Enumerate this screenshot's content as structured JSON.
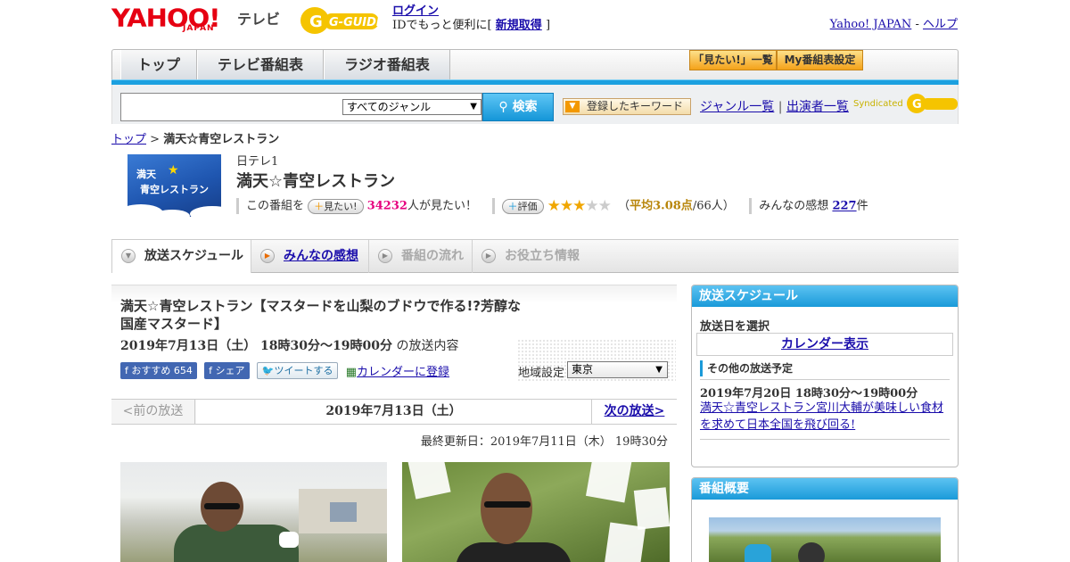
{
  "header": {
    "logo_yahoo": "YAHOO!",
    "logo_japan": "JAPAN",
    "logo_tv": "テレビ",
    "gguide_logo": "G-GUIDE",
    "login_label": "ログイン",
    "id_prefix": "IDでもっと便利に[",
    "register_label": "新規取得",
    "id_suffix": "]",
    "yahoo_japan_link": "Yahoo! JAPAN",
    "separator": "-",
    "help_link": "ヘルプ"
  },
  "nav": {
    "tabs": [
      "トップ",
      "テレビ番組表",
      "ラジオ番組表"
    ],
    "mitai_list": "「見たい!」一覧",
    "my_bangumi": "My番組表設定"
  },
  "search": {
    "genre_selected": "すべてのジャンル",
    "search_button": "検索",
    "keyword_button": "登録したキーワード",
    "genre_list_link": "ジャンル一覧",
    "divider": "|",
    "performer_list_link": "出演者一覧",
    "syndicated": "Syndicated"
  },
  "breadcrumb": {
    "home": "トップ",
    "sep": ">",
    "current": "満天☆青空レストラン"
  },
  "program": {
    "thumb_line1": "満天",
    "thumb_line2": "青空レストラン",
    "channel": "日テレ1",
    "title": "満天☆青空レストラン",
    "watch_prefix": "この番組を",
    "mitai_pill": "見たい!",
    "watch_count": "34232",
    "watch_suffix": "人が見たい！",
    "rating_pill": "評価",
    "stars": "★★★",
    "stars_off": "★★",
    "avg_open": "（",
    "avg_label": "平均3.08点",
    "avg_count": "/66人）",
    "comments_prefix": "みんなの感想",
    "comments_count": "227",
    "comments_suffix": "件"
  },
  "program_tabs": [
    "放送スケジュール",
    "みんなの感想",
    "番組の流れ",
    "お役立ち情報"
  ],
  "episode": {
    "title": "満天☆青空レストラン【マスタードを山梨のブドウで作る!?芳醇な国産マスタード】",
    "date": "2019年7月13日（土） 18時30分～19時00分",
    "date_suffix": "の放送内容",
    "fb_recommend": "おすすめ",
    "fb_count": "654",
    "fb_share": "シェア",
    "tweet": "ツイートする",
    "calendar_register": "カレンダーに登録",
    "region_label": "地域設定",
    "region_value": "東京",
    "prev": "<前の放送",
    "current_date": "2019年7月13日（土）",
    "next": "次の放送>",
    "updated": "最終更新日：2019年7月11日（木） 19時30分"
  },
  "sidebar": {
    "schedule_header": "放送スケジュール",
    "select_date": "放送日を選択",
    "calendar_button": "カレンダー表示",
    "other_schedule": "その他の放送予定",
    "next_date": "2019年7月20日 18時30分～19時00分",
    "next_title": "満天☆青空レストラン宮川大輔が美味しい食材を求めて日本全国を飛び回る!",
    "summary_header": "番組概要"
  },
  "colors": {
    "accent_blue": "#1ba0e0",
    "brand_red": "#e60012",
    "pink_count": "#e6007e",
    "star_gold": "#f0a600"
  },
  "icons": [
    "search-icon",
    "triangle-down-icon",
    "facebook-icon",
    "twitter-icon",
    "calendar-icon",
    "plus-icon",
    "play-icon"
  ]
}
